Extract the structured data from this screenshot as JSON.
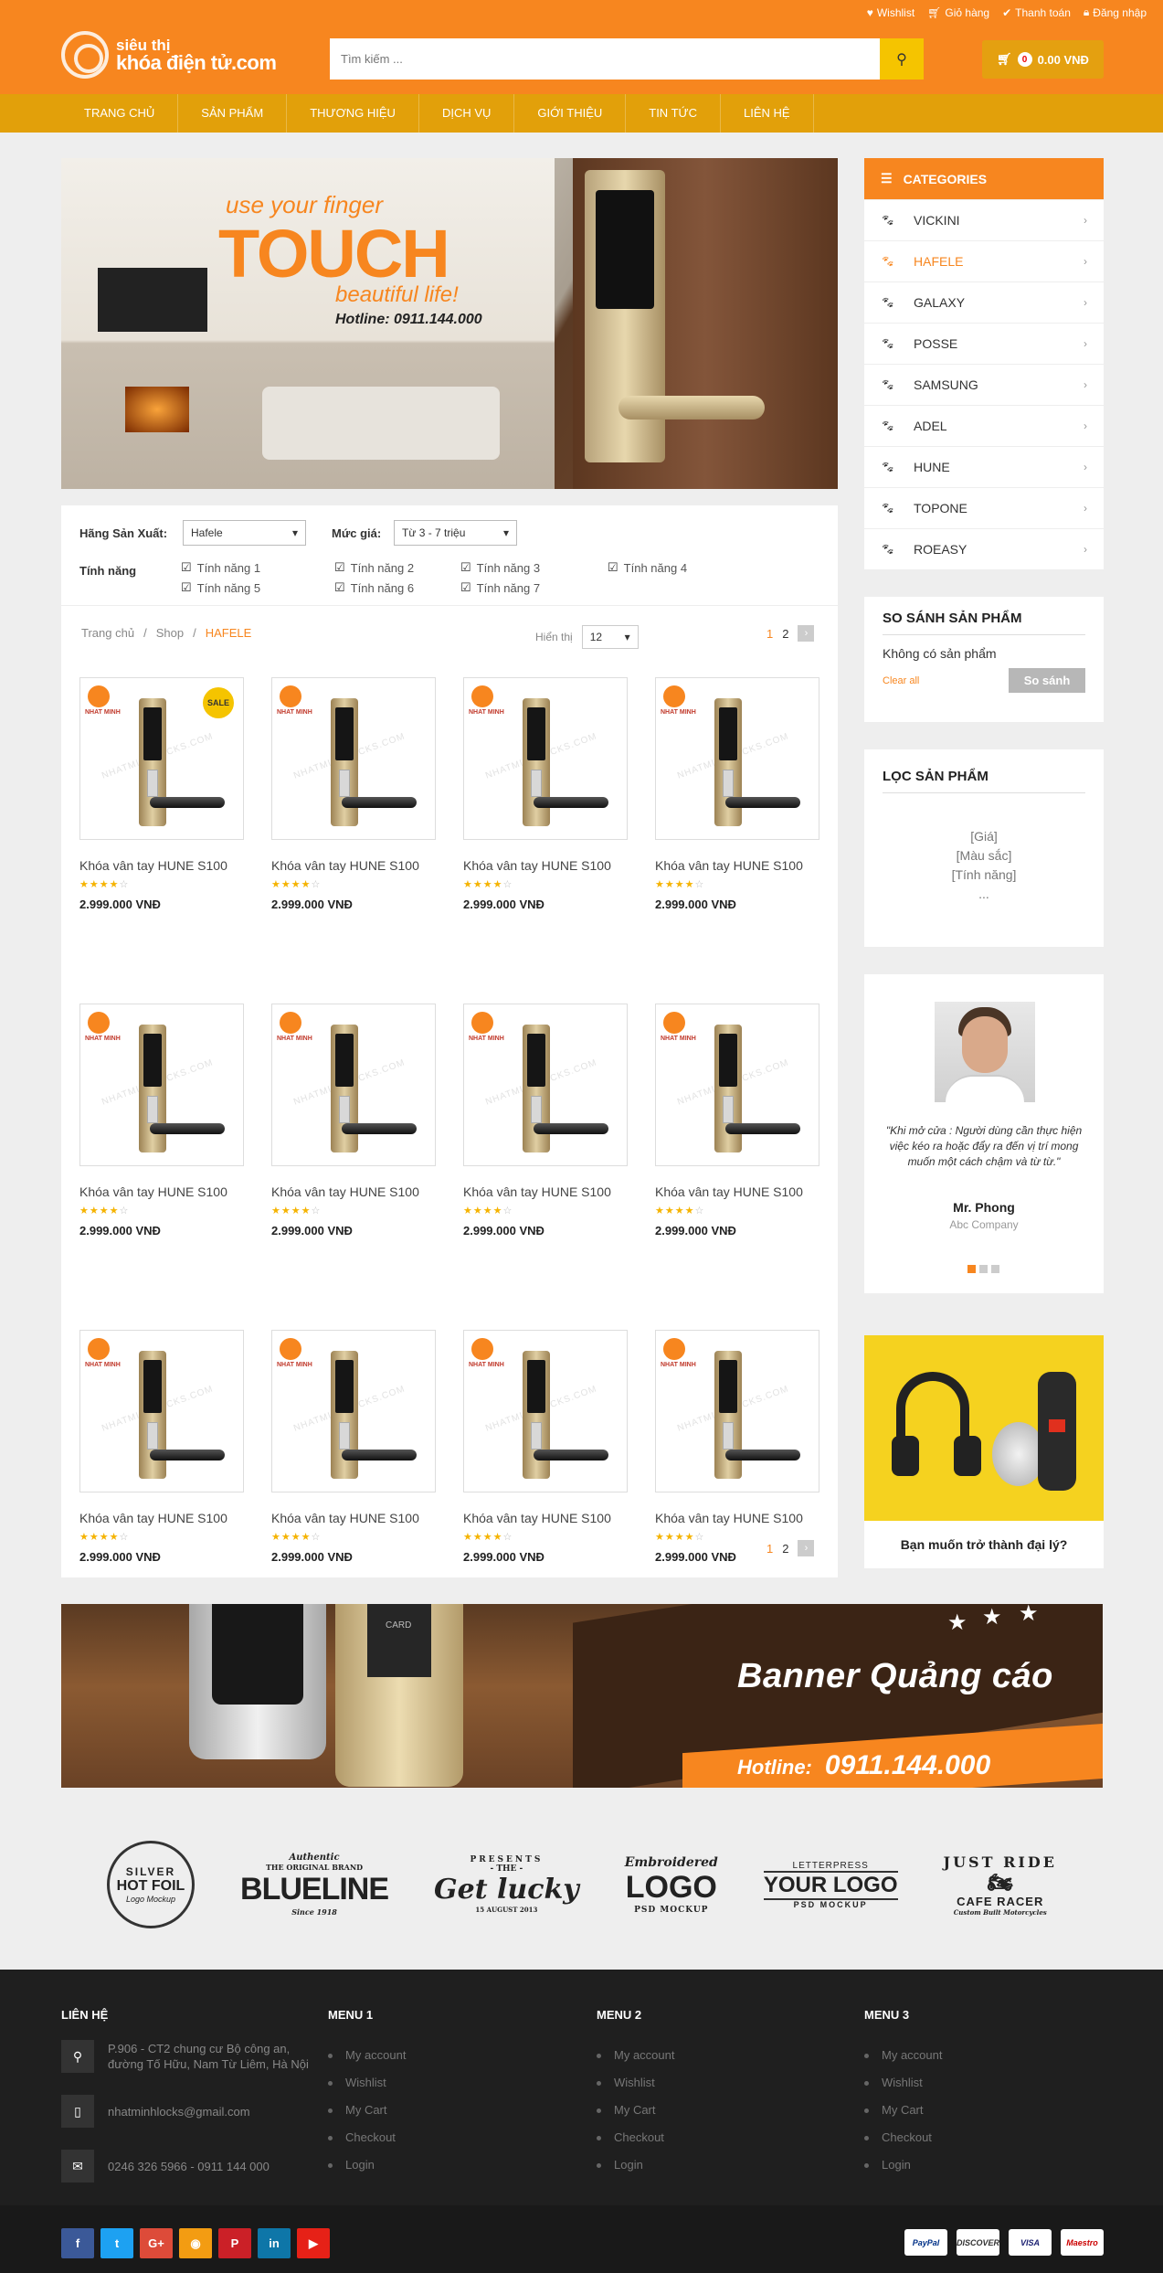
{
  "topbar": {
    "wishlist": "Wishlist",
    "cart": "Giỏ hàng",
    "checkout": "Thanh toán",
    "login": "Đăng nhập"
  },
  "logo": {
    "line1": "siêu thị",
    "line2": "khóa điện tử.com"
  },
  "search": {
    "placeholder": "Tìm kiếm ..."
  },
  "cart": {
    "count": "0",
    "total": "0.00 VNĐ"
  },
  "nav": [
    "TRANG CHỦ",
    "SẢN PHẨM",
    "THƯƠNG HIỆU",
    "DỊCH VỤ",
    "GIỚI THIỆU",
    "TIN TỨC",
    "LIÊN HỆ"
  ],
  "hero": {
    "line1": "use your finger",
    "line2": "TOUCH",
    "line3": "beautiful life!",
    "hotline": "Hotline:  0911.144.000"
  },
  "filters": {
    "brand_label": "Hãng Sản Xuất:",
    "brand_value": "Hafele",
    "price_label": "Mức giá:",
    "price_value": "Từ 3 - 7 triệu",
    "features_label": "Tính năng",
    "features": [
      "Tính năng 1",
      "Tính năng 2",
      "Tính năng 3",
      "Tính năng 4",
      "Tính năng 5",
      "Tính năng 6",
      "Tính năng 7"
    ]
  },
  "breadcrumb": {
    "home": "Trang chủ",
    "sep": "/",
    "shop": "Shop",
    "current": "HAFELE"
  },
  "show": {
    "label": "Hiển thị",
    "value": "12"
  },
  "pager": {
    "p1": "1",
    "p2": "2",
    "next": "›"
  },
  "product": {
    "name": "Khóa vân tay HUNE S100",
    "price": "2.999.000 VNĐ",
    "rating": 4,
    "rating_max": 5,
    "brand_mark": "NHAT MINH",
    "watermark": "NHATMINHLOCKS.COM",
    "sale": "SALE",
    "count": 12
  },
  "categories": {
    "title": "CATEGORIES",
    "items": [
      "VICKINI",
      "HAFELE",
      "GALAXY",
      "POSSE",
      "SAMSUNG",
      "ADEL",
      "HUNE",
      "TOPONE",
      "ROEASY"
    ],
    "active": "HAFELE"
  },
  "compare": {
    "title": "SO SÁNH SẢN PHẨM",
    "empty": "Không có sản phẩm",
    "clear": "Clear all",
    "button": "So sánh"
  },
  "product_filter": {
    "title": "LỌC SẢN PHẨM",
    "items": [
      "[Giá]",
      "[Màu sắc]",
      "[Tính năng]",
      "..."
    ]
  },
  "testimonial": {
    "quote": "\"Khi mở cửa : Người dùng cần thực hiện việc kéo ra hoặc đẩy ra đến vị trí mong muốn một cách chậm và từ từ.\"",
    "name": "Mr. Phong",
    "company": "Abc Company"
  },
  "dealer": {
    "caption": "Bạn muốn trở thành đại lý?"
  },
  "banner2": {
    "title": "Banner Quảng cáo",
    "hotline_label": "Hotline:",
    "hotline": "0911.144.000",
    "card": "CARD"
  },
  "brands": {
    "b1": {
      "top": "SILVER",
      "mid": "HOT FOIL",
      "bot": "Logo Mockup"
    },
    "b2": {
      "top": "Authentic",
      "sub": "THE ORIGINAL BRAND",
      "mid": "BLUELINE",
      "bot": "Since 1918"
    },
    "b3": {
      "top": "PRESENTS",
      "sub": "- THE -",
      "mid": "Get lucky",
      "bot": "15 AUGUST 2013"
    },
    "b4": {
      "top": "Embroidered",
      "mid": "LOGO",
      "bot": "PSD MOCKUP"
    },
    "b5": {
      "top": "LETTERPRESS",
      "mid": "YOUR LOGO",
      "bot": "PSD MOCKUP"
    },
    "b6": {
      "top": "JUST RIDE",
      "mid": "CAFE RACER",
      "bot": "Custom Built Motorcycles"
    }
  },
  "footer": {
    "contact_title": "LIÊN HỆ",
    "address": "P.906 - CT2 chung cư Bộ công an, đường Tố Hữu, Nam Từ Liêm, Hà Nội",
    "email": "nhatminhlocks@gmail.com",
    "phone": "0246 326 5966 - 0911 144 000",
    "menus": [
      {
        "title": "MENU 1",
        "items": [
          "My account",
          "Wishlist",
          "My Cart",
          "Checkout",
          "Login"
        ]
      },
      {
        "title": "MENU 2",
        "items": [
          "My account",
          "Wishlist",
          "My Cart",
          "Checkout",
          "Login"
        ]
      },
      {
        "title": "MENU 3",
        "items": [
          "My account",
          "Wishlist",
          "My Cart",
          "Checkout",
          "Login"
        ]
      }
    ]
  },
  "social": [
    {
      "icon": "facebook-icon",
      "glyph": "f",
      "color": "#3b5998"
    },
    {
      "icon": "twitter-icon",
      "glyph": "t",
      "color": "#1da1f2"
    },
    {
      "icon": "google-plus-icon",
      "glyph": "G+",
      "color": "#dd4b39"
    },
    {
      "icon": "rss-icon",
      "glyph": "◉",
      "color": "#f39c12"
    },
    {
      "icon": "pinterest-icon",
      "glyph": "P",
      "color": "#cb2027"
    },
    {
      "icon": "linkedin-icon",
      "glyph": "in",
      "color": "#0e76a8"
    },
    {
      "icon": "youtube-icon",
      "glyph": "▶",
      "color": "#e62117"
    }
  ],
  "payments": [
    {
      "name": "PayPal",
      "color": "#003087"
    },
    {
      "name": "DISCOVER",
      "color": "#333333"
    },
    {
      "name": "VISA",
      "color": "#1a1f71"
    },
    {
      "name": "Maestro",
      "color": "#cc0000"
    }
  ],
  "colors": {
    "primary": "#f7861f",
    "nav": "#e2a00a",
    "accent": "#f5c400"
  }
}
